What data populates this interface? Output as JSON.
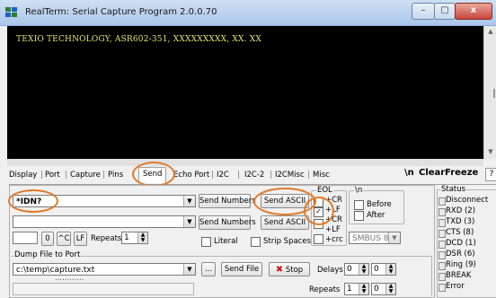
{
  "window": {
    "title": "RealTerm: Serial Capture Program 2.0.0.70",
    "min_label": "–",
    "max_label": "▢",
    "close_label": "x"
  },
  "terminal": {
    "text": "TEXIO TECHNOLOGY, ASR602-351, XXXXXXXXX, XX. XX",
    "text_color": "#e8e36a",
    "background": "#000000"
  },
  "tabs": [
    {
      "label": "Display"
    },
    {
      "label": "Port"
    },
    {
      "label": "Capture"
    },
    {
      "label": "Pins"
    },
    {
      "label": "Send"
    },
    {
      "label": "Echo Port"
    },
    {
      "label": "I2C"
    },
    {
      "label": "I2C-2"
    },
    {
      "label": "I2CMisc"
    },
    {
      "label": "Misc"
    }
  ],
  "active_tab": "Send",
  "toolbar_right": {
    "newline": "\\n",
    "clear": "Clear",
    "freeze": "Freeze",
    "help": "?"
  },
  "send": {
    "line1_value": "*IDN?",
    "line2_value": "",
    "send_numbers_label": "Send Numbers",
    "send_ascii_label": "Send ASCII",
    "send_numbers2_label": "Send Numbers",
    "send_ascii2_label": "Send ASCII",
    "zero_btn": "0",
    "ctrl_c_btn": "^C",
    "lf_btn": "LF",
    "repeats_label": "Repeats",
    "repeats_value": "1",
    "literal_label": "Literal",
    "strip_spaces_label": "Strip Spaces",
    "eol_label": "EOL",
    "cr_label": "+CR",
    "lf_label": "+LF",
    "cr2_label": "+CR",
    "lf2_label": "+LF",
    "crc_label": "+crc",
    "lf_checked": "✓",
    "nl_label": "\\n",
    "before_label": "Before",
    "after_label": "After",
    "smbus_value": "SMBUS 8"
  },
  "dump": {
    "label": "Dump File to Port",
    "path": "c:\\temp\\capture.txt",
    "browse": "...",
    "send_file": "Send File",
    "stop": "Stop",
    "stop_icon": "✖",
    "delays_label": "Delays",
    "delay1": "0",
    "delay2": "0",
    "repeats_label": "Repeats",
    "repeat1": "1",
    "repeat2": "0",
    "progress_text": "............"
  },
  "status": {
    "title": "Status",
    "items": [
      {
        "label": "Disconnect"
      },
      {
        "label": "RXD (2)"
      },
      {
        "label": "TXD (3)"
      },
      {
        "label": "CTS (8)"
      },
      {
        "label": "DCD (1)"
      },
      {
        "label": "DSR (6)"
      },
      {
        "label": "Ring (9)"
      },
      {
        "label": "BREAK"
      },
      {
        "label": "Error"
      }
    ]
  },
  "colors": {
    "highlight_ring": "#e07a2a",
    "stop_icon": "#cc1a1a"
  }
}
